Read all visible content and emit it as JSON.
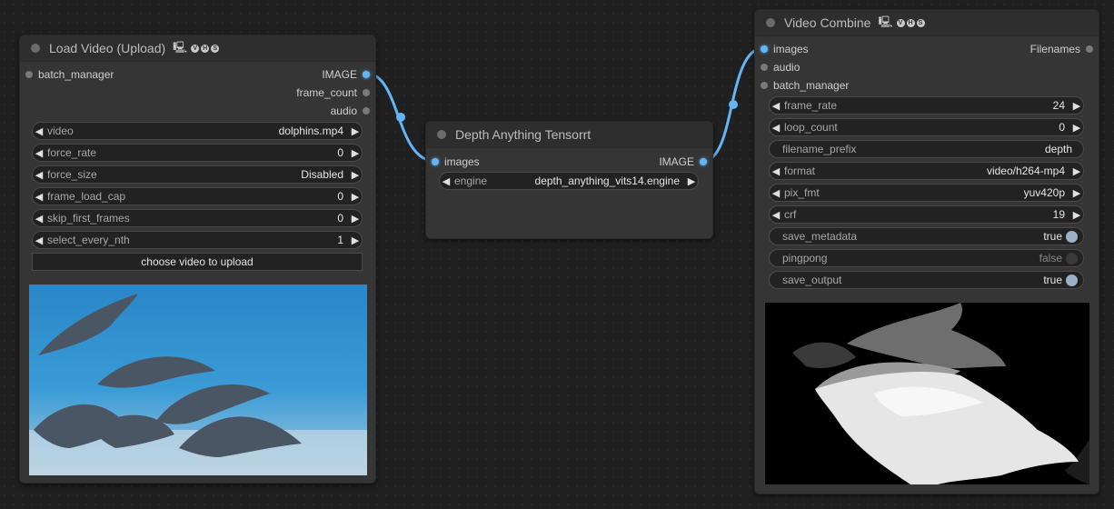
{
  "nodes": {
    "load_video": {
      "title": "Load Video (Upload)",
      "badge_icons": [
        "computer-icon",
        "v-badge",
        "h-badge",
        "s-badge"
      ],
      "inputs": [
        {
          "label": "batch_manager"
        }
      ],
      "outputs": [
        {
          "label": "IMAGE"
        },
        {
          "label": "frame_count"
        },
        {
          "label": "audio"
        }
      ],
      "widgets": [
        {
          "label": "video",
          "value": "dolphins.mp4"
        },
        {
          "label": "force_rate",
          "value": "0"
        },
        {
          "label": "force_size",
          "value": "Disabled"
        },
        {
          "label": "frame_load_cap",
          "value": "0"
        },
        {
          "label": "skip_first_frames",
          "value": "0"
        },
        {
          "label": "select_every_nth",
          "value": "1"
        }
      ],
      "upload_button": "choose video to upload"
    },
    "depth": {
      "title": "Depth Anything Tensorrt",
      "inputs": [
        {
          "label": "images"
        }
      ],
      "outputs": [
        {
          "label": "IMAGE"
        }
      ],
      "widgets": [
        {
          "label": "engine",
          "value": "depth_anything_vits14.engine"
        }
      ]
    },
    "video_combine": {
      "title": "Video Combine",
      "badge_icons": [
        "computer-icon",
        "v-badge",
        "h-badge",
        "s-badge"
      ],
      "inputs": [
        {
          "label": "images"
        },
        {
          "label": "audio"
        },
        {
          "label": "batch_manager"
        }
      ],
      "outputs": [
        {
          "label": "Filenames"
        }
      ],
      "widgets": [
        {
          "label": "frame_rate",
          "value": "24"
        },
        {
          "label": "loop_count",
          "value": "0"
        },
        {
          "label": "filename_prefix",
          "value": "depth"
        },
        {
          "label": "format",
          "value": "video/h264-mp4"
        },
        {
          "label": "pix_fmt",
          "value": "yuv420p"
        },
        {
          "label": "crf",
          "value": "19"
        },
        {
          "label": "save_metadata",
          "value": "true"
        },
        {
          "label": "pingpong",
          "value": "false"
        },
        {
          "label": "save_output",
          "value": "true"
        }
      ]
    }
  },
  "colors": {
    "canvas": "#202020",
    "node_bg": "#353535",
    "link": "#64b5f6",
    "slot_connected": "#64b5f6",
    "slot_disconnected": "#7a7a7a"
  }
}
